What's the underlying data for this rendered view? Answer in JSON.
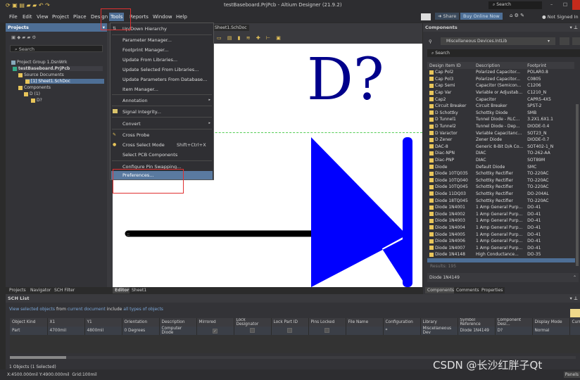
{
  "window": {
    "title": "testBaseboard.PrjPcb - Altium Designer (21.9.2)",
    "search_placeholder": "Search",
    "not_signed_in": "Not Signed In",
    "share": "Share",
    "buy": "Buy Online Now"
  },
  "menubar": [
    "File",
    "Edit",
    "View",
    "Project",
    "Place",
    "Design",
    "Tools",
    "Reports",
    "Window",
    "Help"
  ],
  "tools_menu": {
    "items": [
      {
        "label": "Up/Down Hierarchy"
      },
      {
        "label": "Parameter Manager..."
      },
      {
        "label": "Footprint Manager..."
      },
      {
        "label": "Update From Libraries..."
      },
      {
        "label": "Update Selected From Libraries..."
      },
      {
        "label": "Update Parameters From Database..."
      },
      {
        "label": "Item Manager..."
      },
      {
        "label": "Annotation",
        "submenu": true
      },
      {
        "label": "Signal Integrity..."
      },
      {
        "label": "Convert",
        "submenu": true
      },
      {
        "label": "Cross Probe"
      },
      {
        "label": "Cross Select Mode",
        "shortcut": "Shift+Ctrl+X"
      },
      {
        "label": "Select PCB Components"
      },
      {
        "label": "Configure Pin Swapping..."
      },
      {
        "label": "Preferences...",
        "highlighted": true
      }
    ]
  },
  "projects": {
    "title": "Projects",
    "search": "Search",
    "tree": [
      "Project Group 1.DsnWrk",
      "testBaseboard.PrjPcb",
      "Source Documents",
      "[1] Sheet1.SchDoc",
      "Components",
      "D (1)",
      "D?"
    ],
    "tabs": [
      "Projects",
      "Navigator",
      "SCH Filter"
    ]
  },
  "editor": {
    "doc_tab": "Sheet1.SchDoc",
    "designator": "D?",
    "tabs": [
      "Editor",
      "Sheet1"
    ]
  },
  "components": {
    "title": "Components",
    "library": "Miscellaneous Devices.IntLib",
    "search": "Search",
    "columns": [
      "Design Item ID",
      "Description",
      "Footprint"
    ],
    "rows": [
      [
        "Cap Pol2",
        "Polarized Capacitor...",
        "POLAR0.8"
      ],
      [
        "Cap Pol3",
        "Polarized Capacitor...",
        "C0805"
      ],
      [
        "Cap Semi",
        "Capacitor (Semicon...",
        "C1206"
      ],
      [
        "Cap Var",
        "Variable or Adjustab...",
        "C1210_N"
      ],
      [
        "Cap2",
        "Capacitor",
        "CAPR5-4X5"
      ],
      [
        "Circuit Breaker",
        "Circuit Breaker",
        "SPST-2"
      ],
      [
        "D Schottky",
        "Schottky Diode",
        "SMB"
      ],
      [
        "D Tunnel1",
        "Tunnel Diode - RLC...",
        "3.2X1.6X1.1"
      ],
      [
        "D Tunnel2",
        "Tunnel Diode - Dep...",
        "DIODE-0.4"
      ],
      [
        "D Varactor",
        "Variable Capacitanc...",
        "SOT23_N"
      ],
      [
        "D Zener",
        "Zener Diode",
        "DIODE-0.7"
      ],
      [
        "DAC-8",
        "Generic 8-Bit D/A Co...",
        "SOT402-1_N"
      ],
      [
        "Diac-NPN",
        "DIAC",
        "TO-262-AA"
      ],
      [
        "Diac-PNP",
        "DIAC",
        "SOT89M"
      ],
      [
        "Diode",
        "Default Diode",
        "SMC"
      ],
      [
        "Diode 10TQ035",
        "Schottky Rectifier",
        "TO-220AC"
      ],
      [
        "Diode 10TQ040",
        "Schottky Rectifier",
        "TO-220AC"
      ],
      [
        "Diode 10TQ045",
        "Schottky Rectifier",
        "TO-220AC"
      ],
      [
        "Diode 11DQ03",
        "Schottky Rectifier",
        "DO-204AL"
      ],
      [
        "Diode 18TQ045",
        "Schottky Rectifier",
        "TO-220AC"
      ],
      [
        "Diode 1N4001",
        "1 Amp General Purp...",
        "DO-41"
      ],
      [
        "Diode 1N4002",
        "1 Amp General Purp...",
        "DO-41"
      ],
      [
        "Diode 1N4003",
        "1 Amp General Purp...",
        "DO-41"
      ],
      [
        "Diode 1N4004",
        "1 Amp General Purp...",
        "DO-41"
      ],
      [
        "Diode 1N4005",
        "1 Amp General Purp...",
        "DO-41"
      ],
      [
        "Diode 1N4006",
        "1 Amp General Purp...",
        "DO-41"
      ],
      [
        "Diode 1N4007",
        "1 Amp General Purp...",
        "DO-41"
      ],
      [
        "Diode 1N4148",
        "High Conductance...",
        "DO-35"
      ]
    ],
    "results": "Results: 195",
    "selected": "Diode 1N4149",
    "tabs": [
      "Components",
      "Comments",
      "Properties"
    ]
  },
  "sch_list": {
    "title": "SCH List",
    "filter": [
      "View",
      "selected objects",
      "from",
      "current document",
      "include",
      "all types of objects"
    ],
    "columns": [
      "Object Kind",
      "X1",
      "Y1",
      "Orientation",
      "Description",
      "Mirrored",
      "Lock Designator",
      "Lock Part ID",
      "Pins Locked",
      "File Name",
      "Configuration",
      "Library",
      "Symbol Reference",
      "Component Desi...",
      "Display Mode",
      "Curr"
    ],
    "row": [
      "Part",
      "4700mil",
      "4800mil",
      "0 Degrees",
      "Computer Diode",
      "",
      "",
      "",
      "",
      "",
      "*",
      "Miscellaneous Dev",
      "Diode 1N4149",
      "D?",
      "Normal",
      ""
    ],
    "checked": [
      false,
      false,
      false,
      false,
      false,
      true
    ],
    "summary": "1 Objects (1 Selected)"
  },
  "status": {
    "coords": "X:4500.000mil Y:4900.000mil",
    "grid": "Grid:100mil",
    "panels": "Panels"
  },
  "watermark": "CSDN @长沙红胖子Qt",
  "colors": {
    "accent": "#4e6f96",
    "highlight_box": "#e03030",
    "diode": "#0000ff",
    "designator": "#00008b"
  }
}
